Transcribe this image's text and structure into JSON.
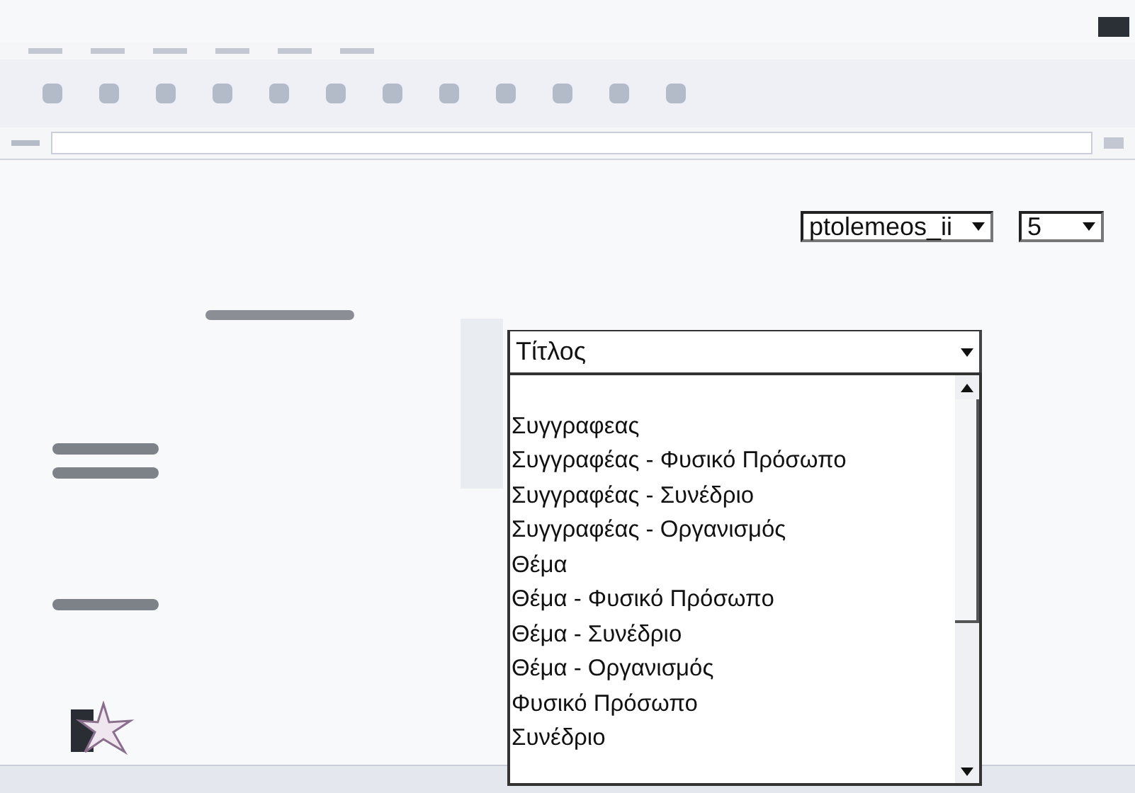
{
  "header_selects": [
    {
      "value": "ptolemeos_ii"
    },
    {
      "value": "5"
    }
  ],
  "search_field_select": {
    "value": "Τίτλος",
    "expanded": true
  },
  "options": [
    {
      "label": "Συγγραφεας",
      "selected": false
    },
    {
      "label": "Συγγραφέας - Φυσικό Πρόσωπο",
      "selected": false
    },
    {
      "label": "Συγγραφέας - Συνέδριο",
      "selected": false
    },
    {
      "label": "Συγγραφέας - Οργανισμός",
      "selected": false
    },
    {
      "label": "Θέμα",
      "selected": false
    },
    {
      "label": "Θέμα - Φυσικό Πρόσωπο",
      "selected": false
    },
    {
      "label": "Θέμα - Συνέδριο",
      "selected": false
    },
    {
      "label": "Θέμα - Οργανισμός",
      "selected": false
    },
    {
      "label": "Φυσικό Πρόσωπο",
      "selected": false
    },
    {
      "label": "Συνέδριο",
      "selected": false
    }
  ]
}
